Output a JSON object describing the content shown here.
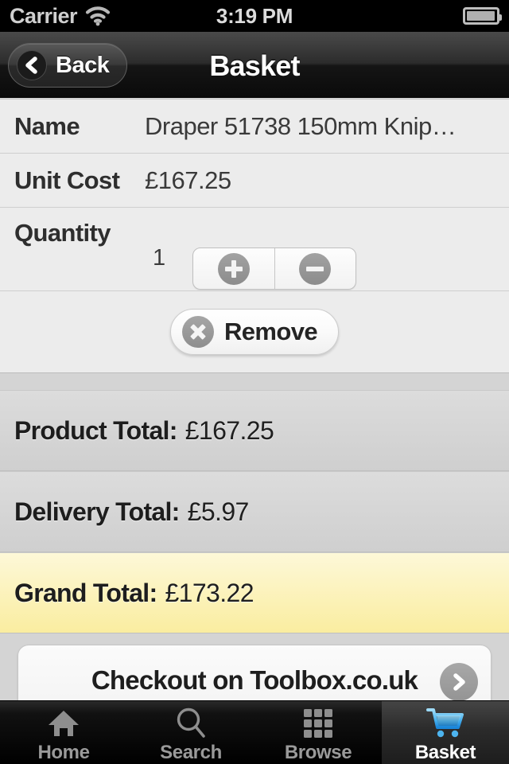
{
  "status_bar": {
    "carrier": "Carrier",
    "wifi_icon": "wifi-icon",
    "time": "3:19 PM",
    "battery_icon": "battery-icon"
  },
  "nav_bar": {
    "back_label": "Back",
    "back_icon": "chevron-left-circle-icon",
    "title": "Basket"
  },
  "product": {
    "name_label": "Name",
    "name_value": "Draper 51738 150mm Knip…",
    "cost_label": "Unit Cost",
    "cost_value": "£167.25",
    "qty_label": "Quantity",
    "qty_value": "1",
    "increment_icon": "plus-circle-icon",
    "decrement_icon": "minus-circle-icon",
    "remove_label": "Remove",
    "remove_icon": "close-circle-icon"
  },
  "totals": [
    {
      "label": "Product Total:",
      "value": "£167.25",
      "style": "gray"
    },
    {
      "label": "Delivery Total:",
      "value": "£5.97",
      "style": "gray"
    },
    {
      "label": "Grand Total:",
      "value": "£173.22",
      "style": "yellow"
    }
  ],
  "checkout": {
    "label": "Checkout on Toolbox.co.uk",
    "icon": "chevron-right-circle-icon"
  },
  "tab_bar": {
    "tabs": [
      {
        "label": "Home",
        "icon": "home-icon",
        "active": false
      },
      {
        "label": "Search",
        "icon": "search-icon",
        "active": false
      },
      {
        "label": "Browse",
        "icon": "grid-icon",
        "active": false
      },
      {
        "label": "Basket",
        "icon": "cart-icon",
        "active": true
      }
    ]
  },
  "colors": {
    "accent_blue": "#3fb6f0",
    "highlight_yellow": "#faeda0",
    "row_background": "#ececec",
    "section_background": "#d4d4d4"
  }
}
